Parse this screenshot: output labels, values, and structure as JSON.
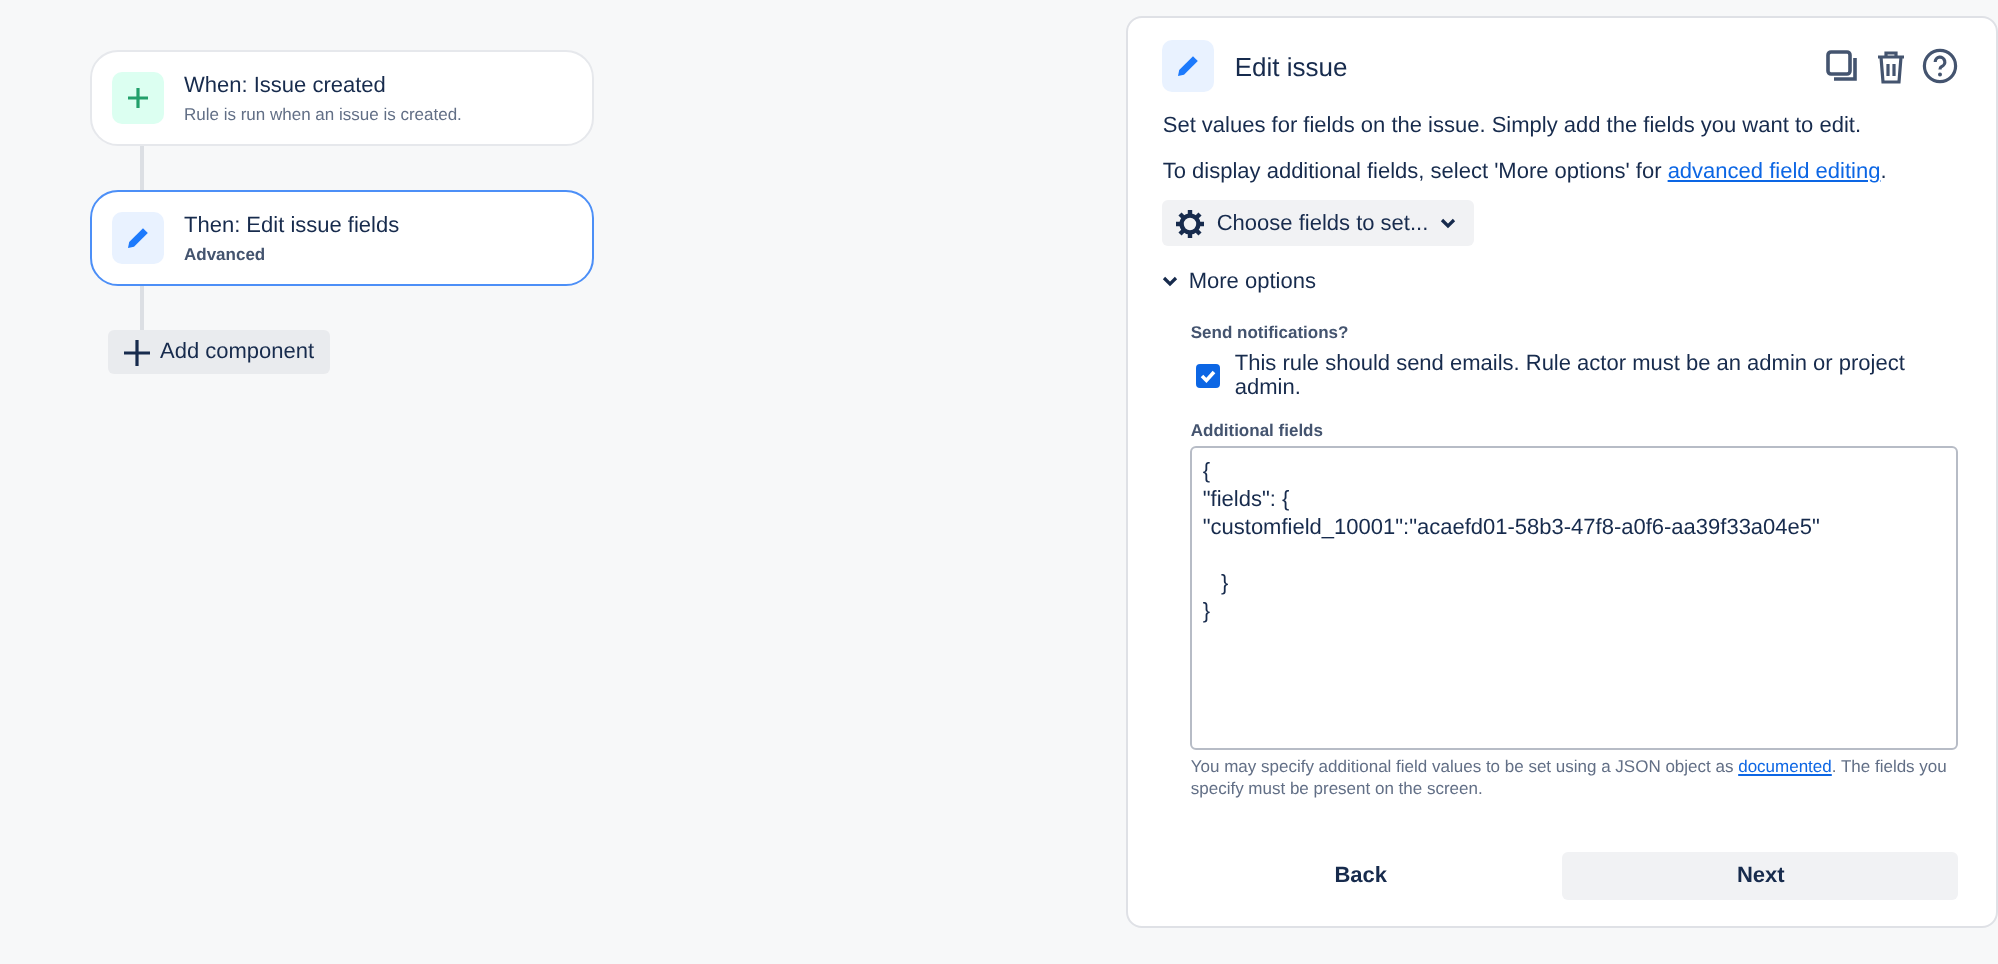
{
  "rule_components": [
    {
      "kind": "trigger",
      "title": "When: Issue created",
      "subtitle": "Rule is run when an issue is created.",
      "selected": false
    },
    {
      "kind": "action",
      "title": "Then: Edit issue fields",
      "subtitle": "Advanced",
      "selected": true
    }
  ],
  "add_component_button": "Add component",
  "panel": {
    "title": "Edit issue",
    "description": "Set values for fields on the issue. Simply add the fields you want to edit.",
    "hint": {
      "before": "To display additional fields, select 'More options' for ",
      "link": "advanced field editing",
      "after": "."
    },
    "choose_fields_button": "Choose fields to set...",
    "more_options": {
      "label": "More options",
      "expanded": true
    },
    "send_notifications": {
      "label": "Send notifications?",
      "checkbox_label": "This rule should send emails. Rule actor must be an admin or project admin.",
      "checked": true
    },
    "additional_fields": {
      "label": "Additional fields",
      "value": "{\n\"fields\": {\n\"customfield_10001\":\"acaefd01-58b3-47f8-a0f6-aa39f33a04e5\"\n\n   }\n}",
      "help": {
        "before": "You may specify additional field values to be set using a JSON object as ",
        "link": "documented",
        "after": ". The fields you specify must be present on the screen."
      }
    },
    "buttons": [
      "Back",
      "Next"
    ]
  }
}
